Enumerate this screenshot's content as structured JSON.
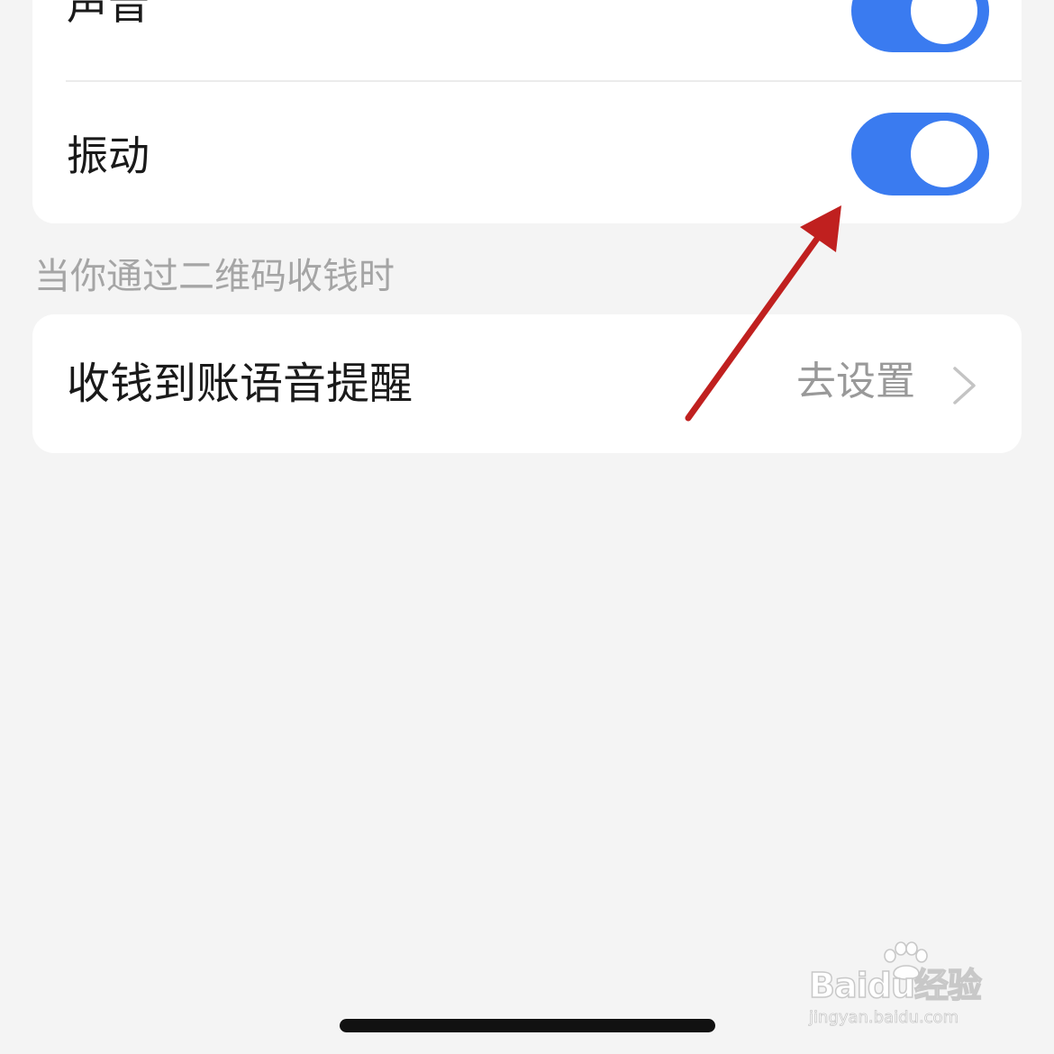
{
  "settings": {
    "sound_label": "声音",
    "sound_on": true,
    "vibrate_label": "振动",
    "vibrate_on": true
  },
  "qr_section": {
    "caption": "当你通过二维码收钱时",
    "voice_reminder_label": "收钱到账语音提醒",
    "voice_reminder_action": "去设置"
  },
  "watermark": {
    "brand": "Baidu经验",
    "url": "jingyan.baidu.com"
  },
  "icons": {
    "chevron": "chevron-right-icon",
    "arrow": "annotation-arrow-icon",
    "paw": "paw-icon"
  },
  "colors": {
    "background": "#f4f4f4",
    "card": "#ffffff",
    "toggle_on": "#3a7bf0",
    "annotation_arrow": "#c0201f",
    "secondary_text": "#a5a5a5"
  }
}
